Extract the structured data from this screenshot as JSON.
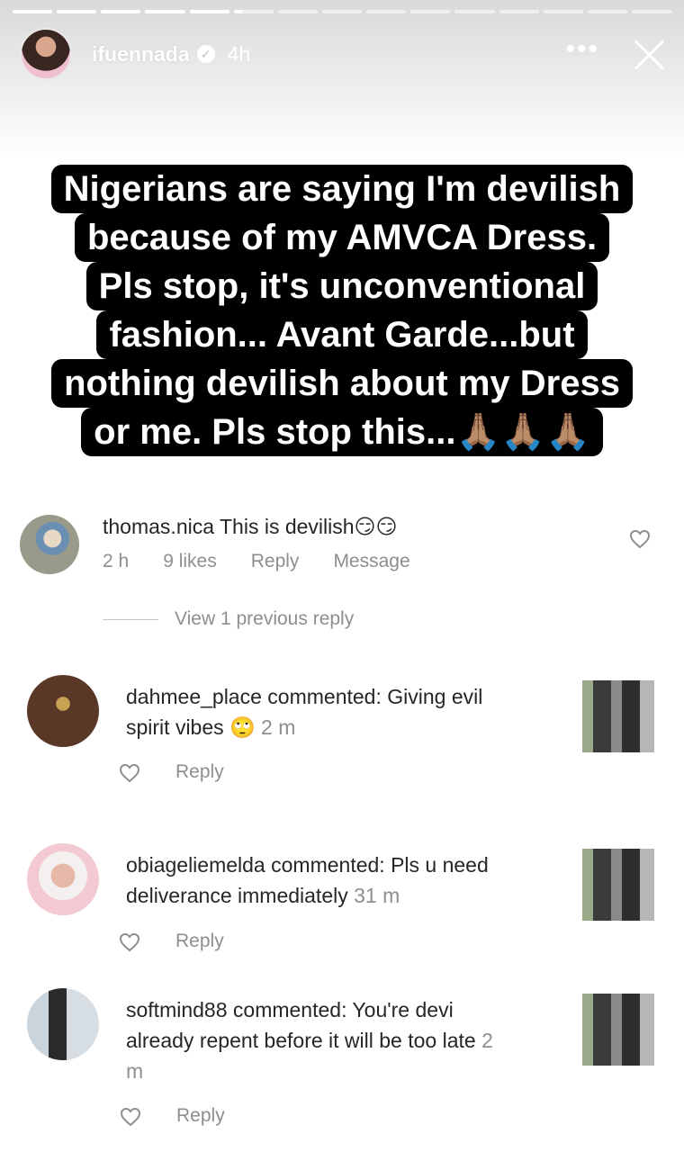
{
  "story": {
    "username": "ifuennada",
    "time": "4h",
    "segments": [
      1,
      1,
      1,
      1,
      1,
      0.2,
      0,
      0,
      0,
      0,
      0,
      0,
      0,
      0,
      0
    ],
    "more_label": "•••"
  },
  "caption": [
    "Nigerians are saying I'm devilish",
    "because of my AMVCA Dress.",
    "Pls stop, it's unconventional",
    "fashion... Avant Garde...but",
    "nothing devilish about my Dress",
    "or me. Pls stop this...🙏🏽🙏🏽🙏🏽"
  ],
  "main_comment": {
    "username": "thomas.nica",
    "text": "This is devilish😏😏",
    "time": "2 h",
    "likes": "9 likes",
    "reply": "Reply",
    "message": "Message"
  },
  "view_previous": "View 1 previous reply",
  "replies": [
    {
      "username": "dahmee_place",
      "line1": " commented: Giving evil",
      "line2": "spirit vibes 🙄",
      "time": " 2 m",
      "line3": "",
      "reply": "Reply"
    },
    {
      "username": "obiageliemelda",
      "line1": " commented: Pls u need",
      "line2": "deliverance immediately",
      "time": " 31 m",
      "line3": "",
      "reply": "Reply"
    },
    {
      "username": "softmind88",
      "line1": " commented: You're devi",
      "line2": "already repent before it will be too late",
      "time": " 2",
      "line3": "m",
      "reply": "Reply"
    }
  ]
}
